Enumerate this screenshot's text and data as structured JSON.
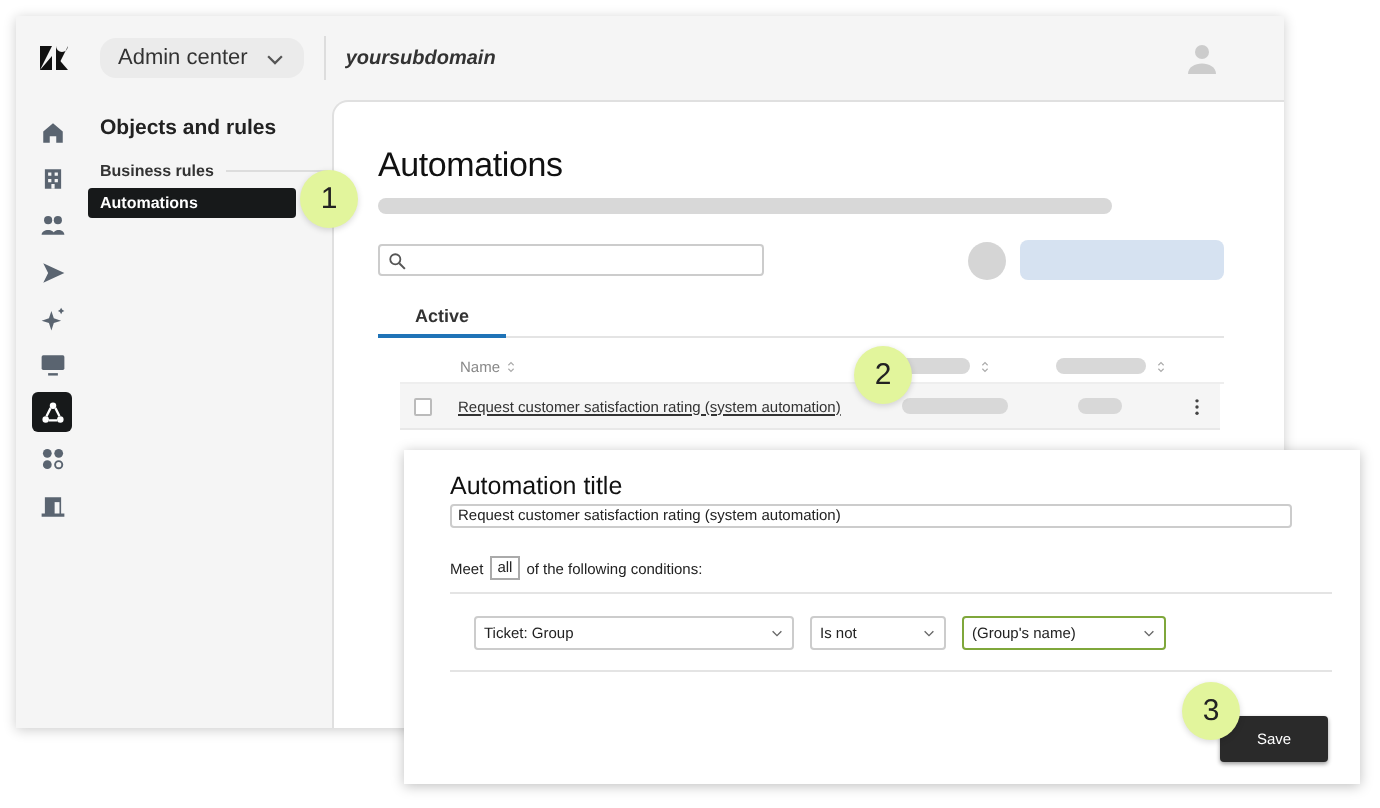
{
  "header": {
    "product_menu": "Admin center",
    "subdomain": "yoursubdomain"
  },
  "rail": [
    {
      "kind": "home",
      "selected": false
    },
    {
      "kind": "building",
      "selected": false
    },
    {
      "kind": "people",
      "selected": false
    },
    {
      "kind": "send",
      "selected": false
    },
    {
      "kind": "sparkle",
      "selected": false
    },
    {
      "kind": "monitor",
      "selected": false
    },
    {
      "kind": "objects",
      "selected": true
    },
    {
      "kind": "apps",
      "selected": false
    },
    {
      "kind": "workspace",
      "selected": false
    }
  ],
  "nav": {
    "title": "Objects and rules",
    "section": "Business rules",
    "items": [
      {
        "label": "Automations",
        "selected": true
      }
    ]
  },
  "main": {
    "title": "Automations",
    "tabs": [
      {
        "label": "Active",
        "selected": true
      }
    ],
    "table": {
      "columns": [
        "Name"
      ],
      "rows": [
        {
          "name": "Request customer satisfaction rating (system automation)",
          "checked": false
        }
      ]
    }
  },
  "editor": {
    "title": "Automation title",
    "value": "Request customer satisfaction rating (system automation)",
    "prefix": "Meet",
    "match": "all",
    "suffix": "of the following conditions:",
    "conditions": [
      {
        "field": "Ticket: Group",
        "operator": "Is not",
        "value": "(Group's name)",
        "highlighted": true
      }
    ],
    "save": "Save"
  },
  "callouts": [
    "1",
    "2",
    "3"
  ]
}
